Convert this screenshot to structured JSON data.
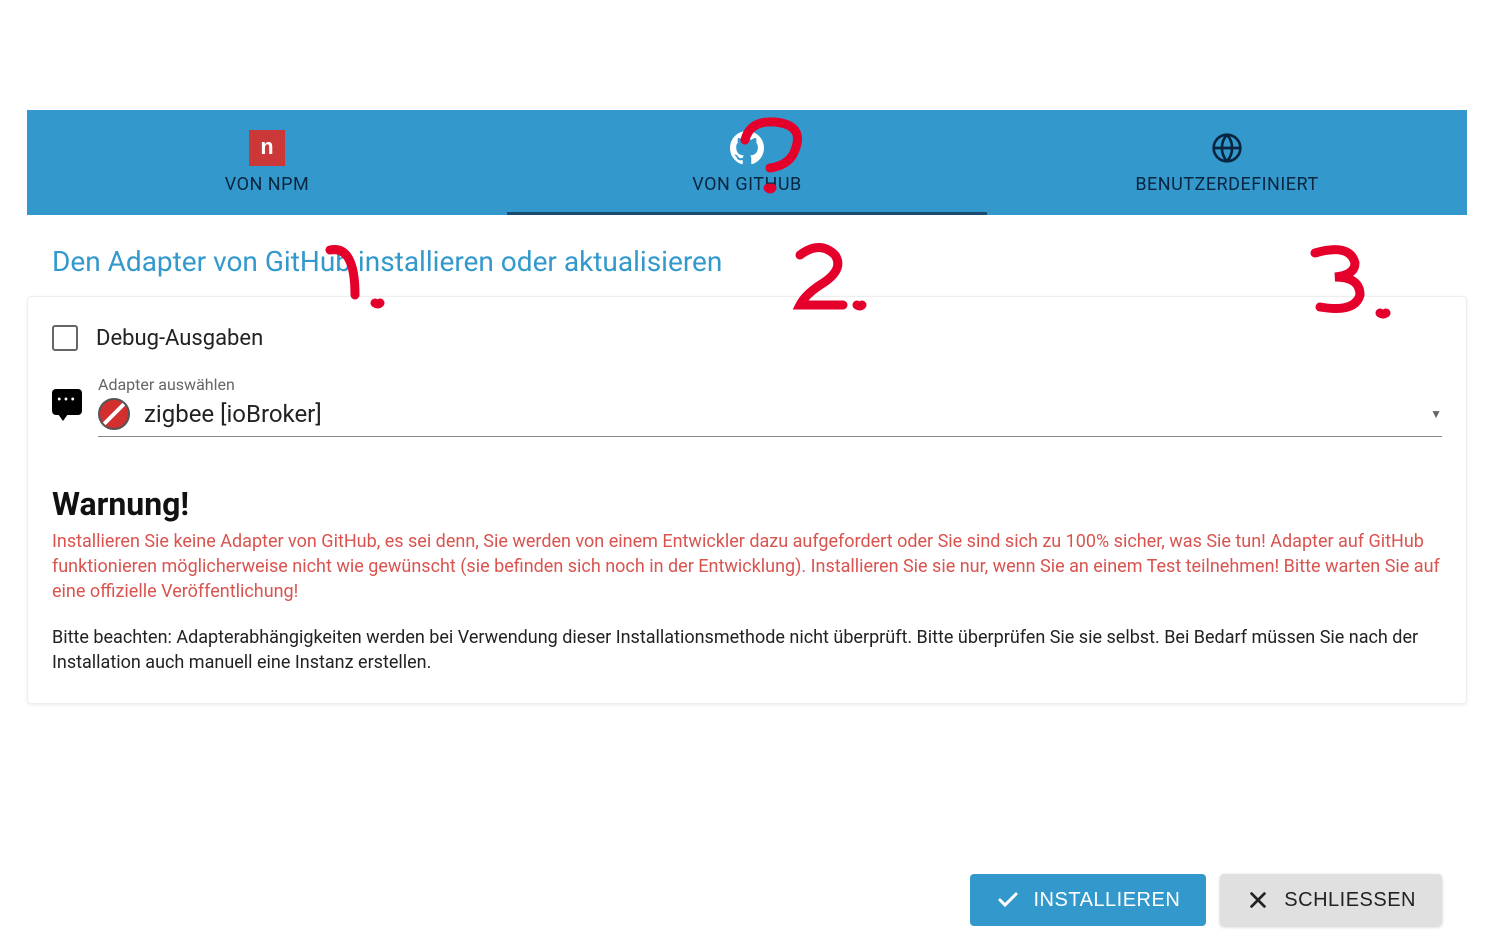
{
  "tabs": [
    {
      "label": "VON NPM",
      "active": false
    },
    {
      "label": "VON GITHUB",
      "active": true
    },
    {
      "label": "BENUTZERDEFINIERT",
      "active": false
    }
  ],
  "page_title": "Den Adapter von GitHub installieren oder aktualisieren",
  "debug": {
    "label": "Debug-Ausgaben",
    "checked": false
  },
  "adapter_select": {
    "label": "Adapter auswählen",
    "value": "zigbee [ioBroker]"
  },
  "warning": {
    "heading": "Warnung!",
    "body": "Installieren Sie keine Adapter von GitHub, es sei denn, Sie werden von einem Entwickler dazu aufgefordert oder Sie sind sich zu 100% sicher, was Sie tun! Adapter auf GitHub funktionieren möglicherweise nicht wie gewünscht (sie befinden sich noch in der Entwicklung). Installieren Sie sie nur, wenn Sie an einem Test teilnehmen! Bitte warten Sie auf eine offizielle Veröffentlichung!",
    "note": "Bitte beachten: Adapterabhängigkeiten werden bei Verwendung dieser Installationsmethode nicht überprüft. Bitte überprüfen Sie sie selbst. Bei Bedarf müssen Sie nach der Installation auch manuell eine Instanz erstellen."
  },
  "buttons": {
    "install": "INSTALLIEREN",
    "close": "SCHLIESSEN"
  },
  "annotations": {
    "question_mark": "?",
    "one": "1.",
    "two": "2.",
    "three": "3."
  }
}
